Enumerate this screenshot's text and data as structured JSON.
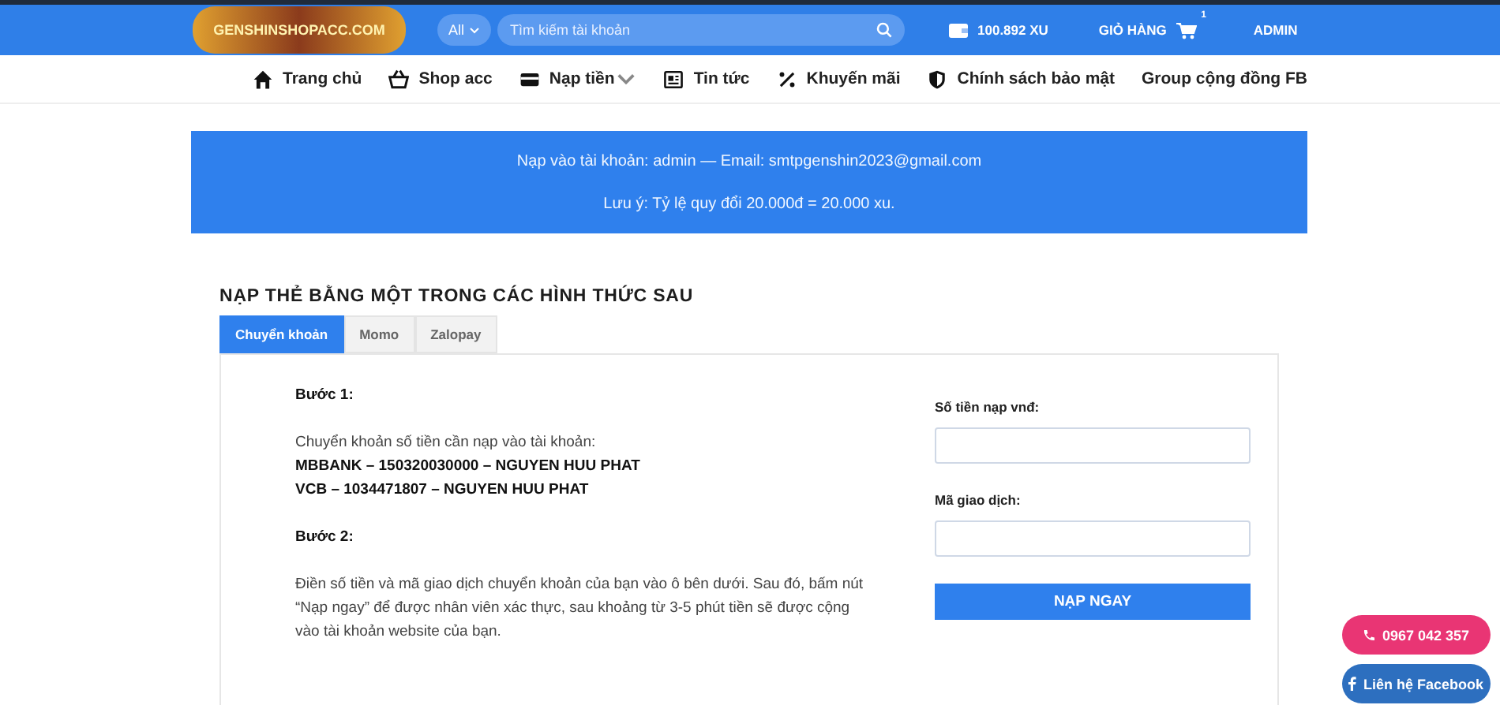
{
  "header": {
    "logo": "GENSHINSHOPACC.COM",
    "search_scope": "All",
    "search": {
      "placeholder": "Tìm kiếm tài khoản"
    },
    "balance": "100.892 XU",
    "cart": {
      "label": "GIỎ HÀNG",
      "count": "1"
    },
    "account": "ADMIN"
  },
  "nav": [
    {
      "label": "Trang chủ",
      "kind": "home",
      "dropdown": false
    },
    {
      "label": "Shop acc",
      "kind": "basket",
      "dropdown": false
    },
    {
      "label": "Nạp tiền",
      "kind": "card",
      "dropdown": true
    },
    {
      "label": "Tin tức",
      "kind": "news",
      "dropdown": false
    },
    {
      "label": "Khuyến mãi",
      "kind": "percent",
      "dropdown": false
    },
    {
      "label": "Chính sách bảo mật",
      "kind": "shield",
      "dropdown": false
    },
    {
      "label": "Group cộng đồng FB",
      "kind": "text",
      "dropdown": false
    }
  ],
  "notice": [
    "Nạp vào tài khoản: admin — Email: smtpgenshin2023@gmail.com",
    "Lưu ý: Tỷ lệ quy đổi 20.000đ = 20.000 xu."
  ],
  "heading": "NẠP THẺ BẰNG MỘT TRONG CÁC HÌNH THỨC SAU",
  "tabs": [
    {
      "label": "Chuyển khoản",
      "selected": true
    },
    {
      "label": "Momo",
      "selected": false
    },
    {
      "label": "Zalopay",
      "selected": false
    }
  ],
  "instructions": [
    {
      "kind": "step",
      "text": "Bước 1:"
    },
    {
      "kind": "para",
      "text": "Chuyển khoản số tiền cần nạp vào tài khoản:"
    },
    {
      "kind": "bold",
      "text": "MBBANK – 150320030000 – NGUYEN HUU PHAT"
    },
    {
      "kind": "bold",
      "text": "VCB – 1034471807 – NGUYEN HUU PHAT"
    },
    {
      "kind": "step",
      "text": "Bước 2:"
    },
    {
      "kind": "para",
      "text": "Điền số tiền và mã giao dịch chuyển khoản của bạn vào ô bên dưới. Sau đó, bấm nút “Nạp ngay” để được nhân viên xác thực, sau khoảng từ 3-5 phút tiền sẽ được cộng vào tài khoản website của bạn."
    }
  ],
  "form": {
    "fields": [
      {
        "label": "Số tiền nạp vnđ:"
      },
      {
        "label": "Mã giao dịch:"
      }
    ],
    "submit": "NẠP NGAY"
  },
  "floating": [
    {
      "kind": "phone",
      "label": "0967 042 357"
    },
    {
      "kind": "facebook",
      "label": "Liên hệ Facebook"
    }
  ]
}
